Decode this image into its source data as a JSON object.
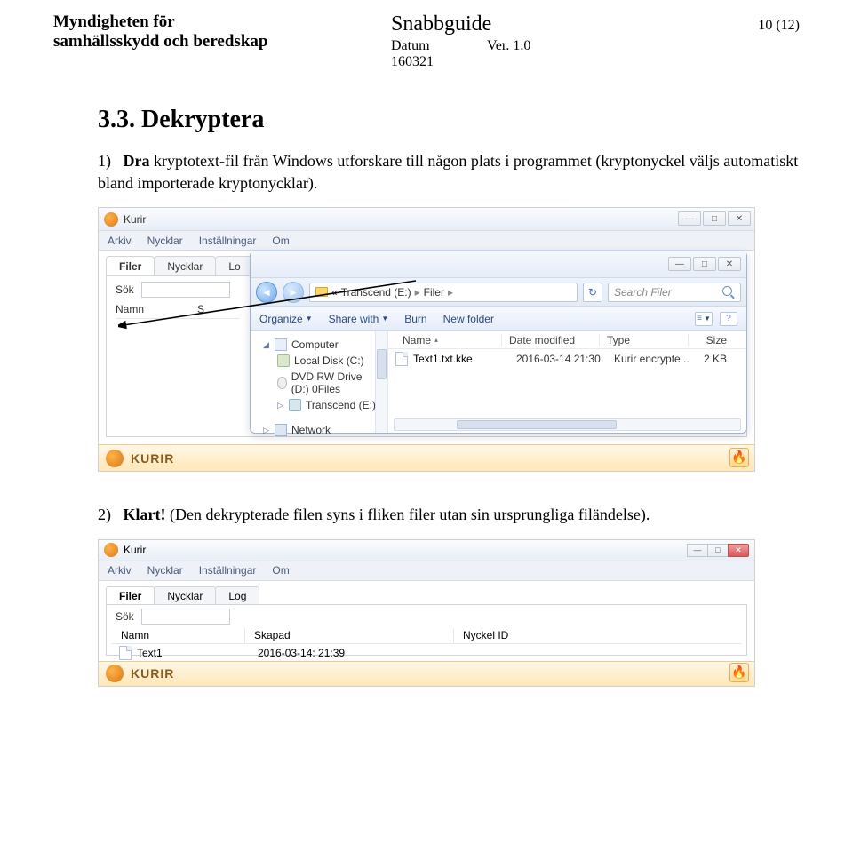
{
  "header": {
    "org_line1": "Myndigheten för",
    "org_line2": "samhällsskydd och beredskap",
    "doc_title": "Snabbguide",
    "datum_label": "Datum",
    "datum_value": "160321",
    "ver_label": "Ver. 1.0",
    "page": "10 (12)"
  },
  "section": {
    "heading": "3.3.   Dekryptera",
    "p1_num": "1)",
    "p1_a": "Dra",
    "p1_b": " kryptotext-fil från Windows utforskare till någon plats i programmet (kryptonyckel väljs automatiskt bland importerade kryptonycklar).",
    "p2_num": "2)",
    "p2_a": "Klart!",
    "p2_b": " (Den dekrypterade filen syns i fliken filer utan sin ursprungliga filändelse)."
  },
  "kurir": {
    "title": "Kurir",
    "menu": {
      "arkiv": "Arkiv",
      "nycklar": "Nycklar",
      "installningar": "Inställningar",
      "om": "Om"
    },
    "tabs": {
      "filer": "Filer",
      "nycklar": "Nycklar",
      "log_trunc": "Lo",
      "log": "Log"
    },
    "sok_label": "Sök",
    "list": {
      "namn": "Namn",
      "s_trunc": "S",
      "skapad": "Skapad",
      "nyckel_id": "Nyckel ID"
    },
    "logo": "KURIR",
    "fire": "🔥",
    "win": {
      "min": "—",
      "max": "□",
      "close": "✕"
    }
  },
  "explorer": {
    "breadcrumb": {
      "prefix": "«",
      "seg1": "Transcend (E:)",
      "seg2": "Filer"
    },
    "refresh": "↻",
    "search_placeholder": "Search Filer",
    "toolbar": {
      "organize": "Organize",
      "share": "Share with",
      "burn": "Burn",
      "newfolder": "New folder"
    },
    "view_icon": "≡",
    "help_icon": "?",
    "tree": {
      "computer": "Computer",
      "localdisk": "Local Disk (C:)",
      "dvd": "DVD RW Drive (D:) 0Files",
      "transcend": "Transcend (E:)",
      "network": "Network"
    },
    "cols": {
      "name": "Name",
      "date": "Date modified",
      "type": "Type",
      "size": "Size"
    },
    "row": {
      "name": "Text1.txt.kke",
      "date": "2016-03-14 21:30",
      "type": "Kurir encrypte...",
      "size": "2 KB"
    },
    "win": {
      "min": "—",
      "max": "□",
      "close": "✕"
    }
  },
  "shot2": {
    "row": {
      "name": "Text1",
      "date": "2016-03-14: 21:39"
    }
  }
}
